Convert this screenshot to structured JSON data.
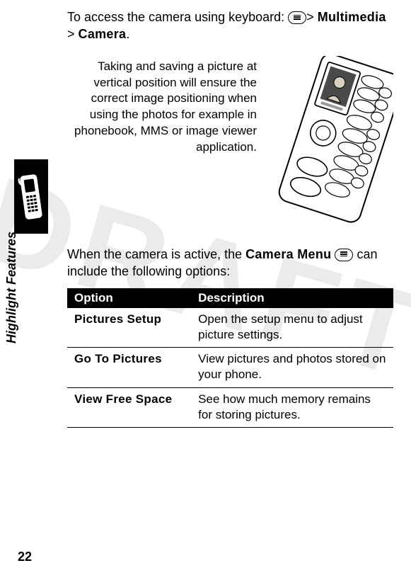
{
  "watermark": "DRAFT",
  "sidebar": {
    "label": "Highlight Features"
  },
  "page_number": "22",
  "intro": {
    "prefix": "To access the camera using keyboard: ",
    "nav1": "Multimedia",
    "sep": " > ",
    "nav2": "Camera",
    "suffix": "."
  },
  "tip": "Taking and saving a picture at vertical position will ensure the correct image positioning when using the photos for example in phonebook, MMS or image viewer application.",
  "camera_menu": {
    "prefix": "When the camera is active, the ",
    "label": "Camera Menu",
    "suffix": " can include the following options:"
  },
  "table": {
    "headers": {
      "option": "Option",
      "description": "Description"
    },
    "rows": [
      {
        "option": "Pictures Setup",
        "description": "Open the setup menu to adjust picture settings."
      },
      {
        "option": "Go To Pictures",
        "description": "View pictures and photos stored on your phone."
      },
      {
        "option": "View Free Space",
        "description": "See how much memory remains for storing pictures."
      }
    ]
  }
}
